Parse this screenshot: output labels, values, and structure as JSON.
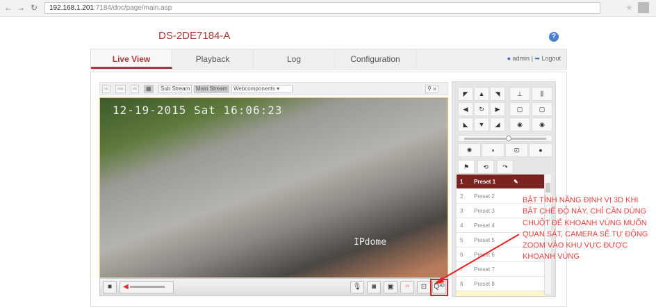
{
  "browser": {
    "url_host": "192.168.1.201",
    "url_path": ":7184/doc/page/main.asp"
  },
  "device_title": "DS-2DE7184-A",
  "help_icon": "?",
  "tabs": [
    {
      "label": "Live View",
      "active": true
    },
    {
      "label": "Playback"
    },
    {
      "label": "Log"
    },
    {
      "label": "Configuration"
    }
  ],
  "user": {
    "name": "admin",
    "logout": "Logout"
  },
  "toolbar": {
    "sub_stream": "Sub Stream",
    "main_stream": "Main Stream",
    "plugin": "Webcomponents"
  },
  "video": {
    "timestamp": "12-19-2015 Sat 16:06:23",
    "watermark": "IPdome"
  },
  "presets": [
    {
      "n": "1",
      "label": "Preset 1",
      "selected": true
    },
    {
      "n": "2",
      "label": "Preset 2"
    },
    {
      "n": "3",
      "label": "Preset 3"
    },
    {
      "n": "4",
      "label": "Preset 4"
    },
    {
      "n": "5",
      "label": "Preset 5"
    },
    {
      "n": "6",
      "label": "Preset 6"
    },
    {
      "n": "7",
      "label": "Preset 7"
    },
    {
      "n": "8",
      "label": "Preset 8"
    }
  ],
  "annotation": "BẬT TÍNH NĂNG ĐỊNH VỊ 3D KHI BẬT CHẾ ĐỘ NÀY, CHỈ CẦN DÙNG CHUỘT ĐỂ KHOANH VÙNG MUỐN QUAN SÁT, CAMERA SẼ TỰ ĐỘNG ZOOM VÀO KHU VỰC ĐƯỢC KHOANH VÙNG",
  "colors": {
    "accent": "#a8383a",
    "selected_preset": "#7a2321",
    "annotation": "#e84040"
  }
}
